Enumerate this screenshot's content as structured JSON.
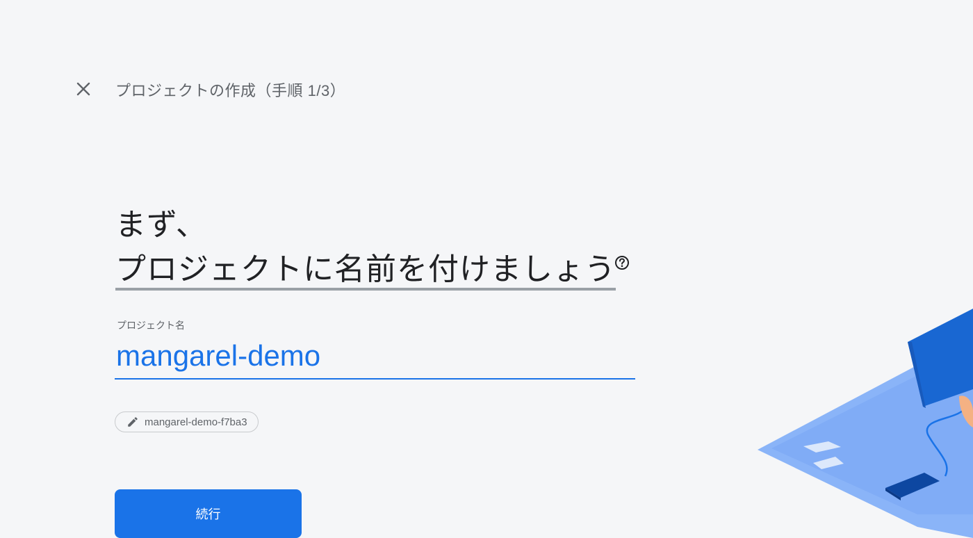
{
  "header": {
    "close_label": "×",
    "step_title": "プロジェクトの作成（手順 1/3）"
  },
  "main": {
    "heading_line1": "まず、",
    "heading_line2": "プロジェクトに名前を付けましょう",
    "help_icon": "help-circle-icon",
    "project_name": {
      "label": "プロジェクト名",
      "value": "mangarel-demo"
    },
    "project_id_chip": {
      "icon": "pencil-icon",
      "text": "mangarel-demo-f7ba3"
    },
    "continue_label": "続行"
  },
  "colors": {
    "accent": "#1a73e8",
    "background": "#f5f6f8",
    "text_primary": "#202124",
    "text_secondary": "#5f6368"
  }
}
